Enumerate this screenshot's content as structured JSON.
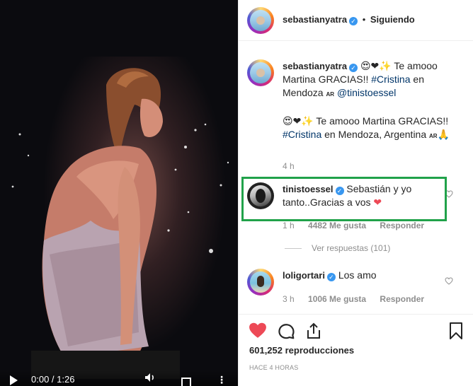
{
  "video": {
    "time": "0:00 / 1:26",
    "controls": [
      "play-icon",
      "volume-icon",
      "fullscreen-icon",
      "more-icon"
    ]
  },
  "post_header": {
    "username": "sebastianyatra",
    "dot": "•",
    "follow_label": "Siguiendo"
  },
  "caption": {
    "username": "sebastianyatra",
    "emoji_1": "😍❤✨",
    "text_1": " Te amooo Martina GRACIAS!! ",
    "hashtag_1": "#Cristina",
    "text_2": " en Mendoza ",
    "flag_1": "AR",
    "mention": "@tinistoessel",
    "emoji_2": "😍❤✨",
    "text_3": " Te amooo Martina GRACIAS!! ",
    "hashtag_2": "#Cristina",
    "text_4": " en Mendoza, Argentina ",
    "flag_2": "AR",
    "emoji_3": "🙏",
    "time": "4 h"
  },
  "comment_1": {
    "username": "tinistoessel",
    "text": "Sebastián y yo tanto..Gracias a vos",
    "emoji": "❤",
    "time": "1 h",
    "likes": "4482 Me gusta",
    "reply": "Responder",
    "view_replies": "Ver respuestas (101)"
  },
  "comment_2": {
    "username": "loligortari",
    "text": "Los amo",
    "time": "3 h",
    "likes": "1006 Me gusta",
    "reply": "Responder"
  },
  "actions": {
    "views": "601,252 reproducciones",
    "ago": "HACE 4 HORAS",
    "icons": [
      "heart-filled-icon",
      "comment-icon",
      "share-icon",
      "bookmark-icon"
    ],
    "like_color": "#ed4956"
  }
}
